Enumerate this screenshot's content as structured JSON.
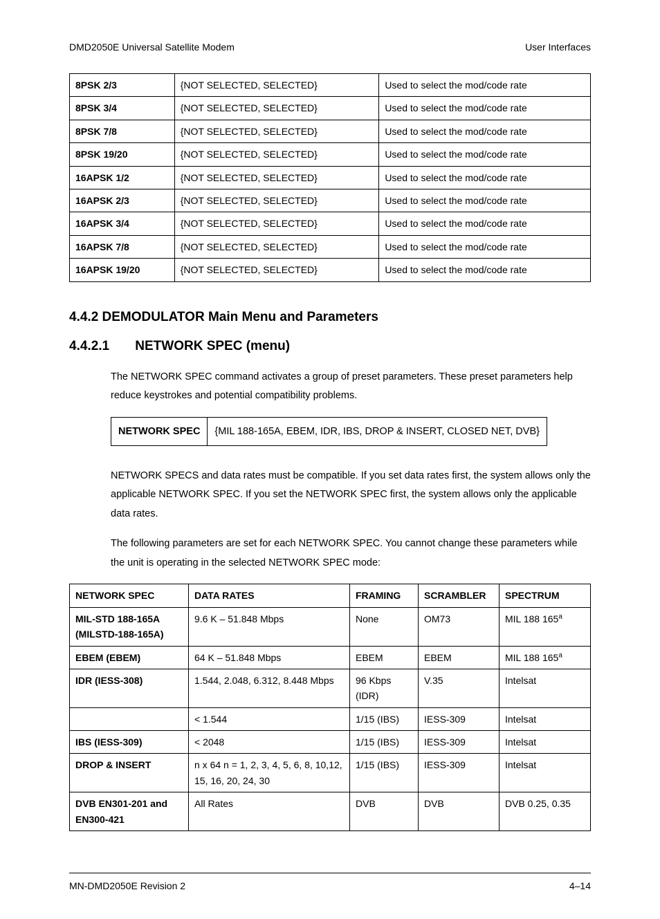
{
  "header": {
    "left": "DMD2050E Universal Satellite Modem",
    "right": "User Interfaces"
  },
  "table1": {
    "rows": [
      {
        "c0": "8PSK 2/3",
        "c1": "{NOT SELECTED, SELECTED}",
        "c2": "Used to select the mod/code rate"
      },
      {
        "c0": "8PSK 3/4",
        "c1": "{NOT SELECTED, SELECTED}",
        "c2": "Used to select the mod/code rate"
      },
      {
        "c0": "8PSK 7/8",
        "c1": "{NOT SELECTED, SELECTED}",
        "c2": "Used to select the mod/code rate"
      },
      {
        "c0": "8PSK 19/20",
        "c1": "{NOT SELECTED, SELECTED}",
        "c2": "Used to select the mod/code rate"
      },
      {
        "c0": "16APSK 1/2",
        "c1": "{NOT SELECTED, SELECTED}",
        "c2": "Used to select the mod/code rate"
      },
      {
        "c0": "16APSK 2/3",
        "c1": "{NOT SELECTED, SELECTED}",
        "c2": "Used to select the mod/code rate"
      },
      {
        "c0": "16APSK 3/4",
        "c1": "{NOT SELECTED, SELECTED}",
        "c2": "Used to select the mod/code rate"
      },
      {
        "c0": "16APSK 7/8",
        "c1": "{NOT SELECTED, SELECTED}",
        "c2": "Used to select the mod/code rate"
      },
      {
        "c0": "16APSK 19/20",
        "c1": "{NOT SELECTED, SELECTED}",
        "c2": "Used to select the mod/code rate"
      }
    ]
  },
  "section_442": "4.4.2  DEMODULATOR Main Menu and Parameters",
  "section_4421_num": "4.4.2.1",
  "section_4421_title": "NETWORK SPEC (menu)",
  "para1": "The NETWORK SPEC command activates a group of preset parameters.  These preset parameters help reduce keystrokes and potential compatibility problems.",
  "inset": {
    "label": "NETWORK SPEC",
    "value": "{MIL 188-165A, EBEM, IDR, IBS, DROP & INSERT, CLOSED NET, DVB}"
  },
  "para2": "NETWORK SPECS and data rates must be compatible.  If you set data rates first, the system allows only the applicable NETWORK SPEC. If you set the NETWORK SPEC first, the system allows only the applicable data rates.",
  "para3": "The following parameters are set for each NETWORK SPEC. You cannot change these parameters while the unit is operating in the selected NETWORK SPEC mode:",
  "table2": {
    "headers": {
      "h0": "NETWORK SPEC",
      "h1": "DATA RATES",
      "h2": "FRAMING",
      "h3": "SCRAMBLER",
      "h4": "SPECTRUM"
    },
    "rows": [
      {
        "c0": "MIL-STD 188-165A (MILSTD-188-165A)",
        "c1": "9.6 K – 51.848 Mbps",
        "c2": "None",
        "c3": "OM73",
        "c4": "MIL 188 165",
        "sup": "a"
      },
      {
        "c0": "EBEM (EBEM)",
        "c1": "64 K – 51.848 Mbps",
        "c2": "EBEM",
        "c3": "EBEM",
        "c4": "MIL 188 165",
        "sup": "a"
      },
      {
        "c0": "IDR (IESS-308)",
        "c1": "1.544, 2.048, 6.312, 8.448 Mbps",
        "c2": "96 Kbps (IDR)",
        "c3": "V.35",
        "c4": "Intelsat"
      },
      {
        "c0": "",
        "c1": "< 1.544",
        "c2": "1/15 (IBS)",
        "c3": "IESS-309",
        "c4": "Intelsat"
      },
      {
        "c0": "IBS (IESS-309)",
        "c1": "< 2048",
        "c2": "1/15 (IBS)",
        "c3": "IESS-309",
        "c4": "Intelsat"
      },
      {
        "c0": "DROP & INSERT",
        "c1": "n x 64 n = 1, 2, 3, 4, 5, 6, 8, 10,12, 15, 16, 20, 24, 30",
        "c2": "1/15 (IBS)",
        "c3": "IESS-309",
        "c4": "Intelsat"
      },
      {
        "c0": "DVB EN301-201 and EN300-421",
        "c1": "All Rates",
        "c2": "DVB",
        "c3": "DVB",
        "c4": "DVB 0.25, 0.35"
      }
    ]
  },
  "footer": {
    "left": "MN-DMD2050E    Revision 2",
    "right": "4–14"
  }
}
